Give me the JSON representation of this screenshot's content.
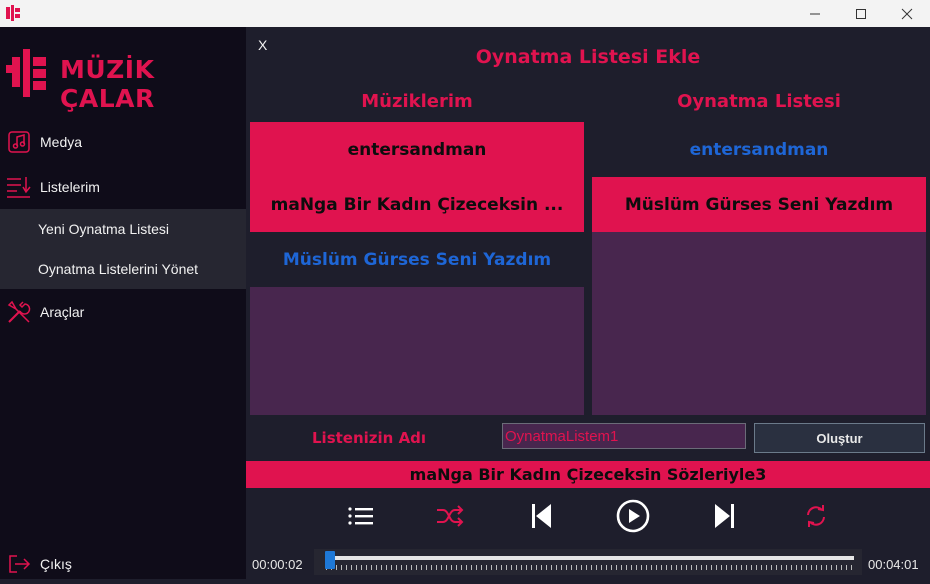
{
  "window": {
    "minimize_icon": "minimize-icon",
    "maximize_icon": "maximize-icon",
    "close_icon": "close-icon"
  },
  "brand": {
    "name": "MÜZİK ÇALAR",
    "color": "#e0134f"
  },
  "sidebar": {
    "items": [
      {
        "label": "Medya",
        "icon": "music-note-icon"
      },
      {
        "label": "Listelerim",
        "icon": "list-icon"
      },
      {
        "label": "Araçlar",
        "icon": "tools-icon"
      }
    ],
    "subitems": [
      {
        "label": "Yeni Oynatma Listesi"
      },
      {
        "label": "Oynatma Listelerini Yönet"
      }
    ],
    "exit_label": "Çıkış"
  },
  "panel": {
    "close_label": "X",
    "title": "Oynatma Listesi Ekle",
    "left_heading": "Müziklerim",
    "right_heading": "Oynatma Listesi",
    "my_music": [
      {
        "title": "entersandman",
        "state": "selected"
      },
      {
        "title": "maNga Bir Kadın Çizeceksin ...",
        "state": "selected"
      },
      {
        "title": "Müslüm Gürses Seni Yazdım",
        "state": "highlighted"
      }
    ],
    "playlist": [
      {
        "title": "entersandman",
        "state": "highlighted"
      },
      {
        "title": "Müslüm Gürses Seni Yazdım",
        "state": "selected"
      }
    ],
    "name_label": "Listenizin Adı",
    "name_value": "OynatmaListem1",
    "create_label": "Oluştur"
  },
  "player": {
    "now_playing": "maNga Bir Kadın Çizeceksin Sözleriyle3",
    "elapsed": "00:00:02",
    "total": "00:04:01",
    "progress": 0.008,
    "icons": [
      "playlist-icon",
      "shuffle-icon",
      "previous-icon",
      "play-icon",
      "next-icon",
      "repeat-icon"
    ]
  }
}
